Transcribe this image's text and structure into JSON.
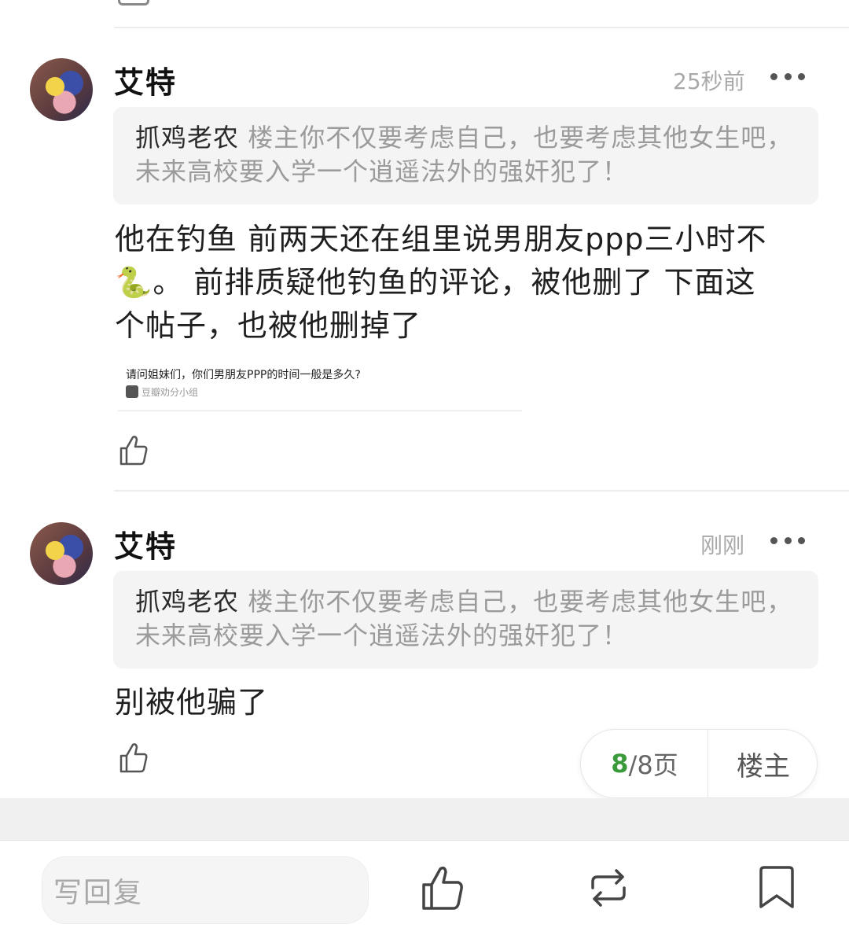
{
  "comments": [
    {
      "author": "艾特",
      "time": "25秒前",
      "quote_name": "抓鸡老农",
      "quote_text": "楼主你不仅要考虑自己，也要考虑其他女生吧，未来高校要入学一个逍遥法外的强奸犯了！",
      "body_lines": [
        "他在钓鱼  前两天还在组里说男朋友ppp三小时不",
        "🐍。  前排质疑他钓鱼的评论，被他删了    下面这",
        "个帖子，也被他删掉了"
      ],
      "card": {
        "title": "请问姐妹们，你们男朋友PPP的时间一般是多久?",
        "source": "豆瓣劝分小组"
      }
    },
    {
      "author": "艾特",
      "time": "刚刚",
      "quote_name": "抓鸡老农",
      "quote_text": "楼主你不仅要考虑自己，也要考虑其他女生吧，未来高校要入学一个逍遥法外的强奸犯了！",
      "body_lines": [
        "别被他骗了"
      ]
    }
  ],
  "pager": {
    "current": "8",
    "total": "/8页",
    "op_label": "楼主"
  },
  "bottom_bar": {
    "reply_placeholder": "写回复",
    "icons": [
      "like-icon",
      "repost-icon",
      "bookmark-icon"
    ]
  }
}
